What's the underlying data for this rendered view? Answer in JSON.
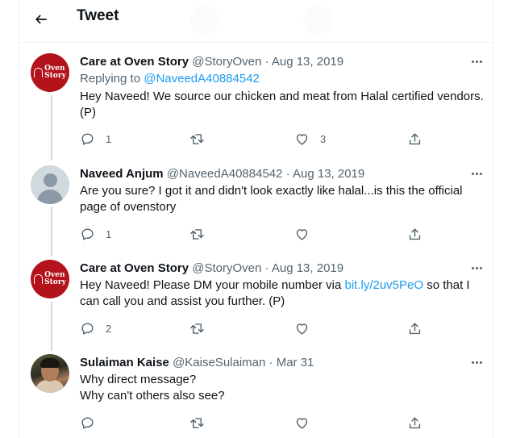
{
  "header": {
    "title": "Tweet"
  },
  "tweets": [
    {
      "name": "Care at Oven Story",
      "handle": "@StoryOven",
      "date": "Aug 13, 2019",
      "replying_prefix": "Replying to",
      "replying_handle": "@NaveedA40884542",
      "text": "Hey Naveed! We source our chicken and meat from Halal certified vendors. (P)",
      "reply_count": "1",
      "retweet_count": "",
      "like_count": "3",
      "avatar_text": [
        "Oven",
        "Story"
      ]
    },
    {
      "name": "Naveed Anjum",
      "handle": "@NaveedA40884542",
      "date": "Aug 13, 2019",
      "text": "Are you sure? I got it and didn't look exactly like halal...is this the official page of ovenstory",
      "reply_count": "1",
      "retweet_count": "",
      "like_count": ""
    },
    {
      "name": "Care at Oven Story",
      "handle": "@StoryOven",
      "date": "Aug 13, 2019",
      "text_before": "Hey Naveed! Please DM your mobile number via ",
      "text_link": "bit.ly/2uv5PeO",
      "text_after": " so that I can call you and assist you further. (P)",
      "reply_count": "2",
      "retweet_count": "",
      "like_count": "",
      "avatar_text": [
        "Oven",
        "Story"
      ]
    },
    {
      "name": "Sulaiman Kaise",
      "handle": "@KaiseSulaiman",
      "date": "Mar 31",
      "text_line1": "Why direct message?",
      "text_line2": "Why can't others also see?",
      "reply_count": "",
      "retweet_count": "",
      "like_count": ""
    }
  ],
  "icons": {
    "back": "arrow-left-icon",
    "more": "more-icon",
    "reply": "reply-icon",
    "retweet": "retweet-icon",
    "like": "heart-icon",
    "share": "share-icon"
  },
  "colors": {
    "link": "#1d9bf0",
    "secondary_text": "#536471",
    "oven_brand": "#b3141c"
  }
}
